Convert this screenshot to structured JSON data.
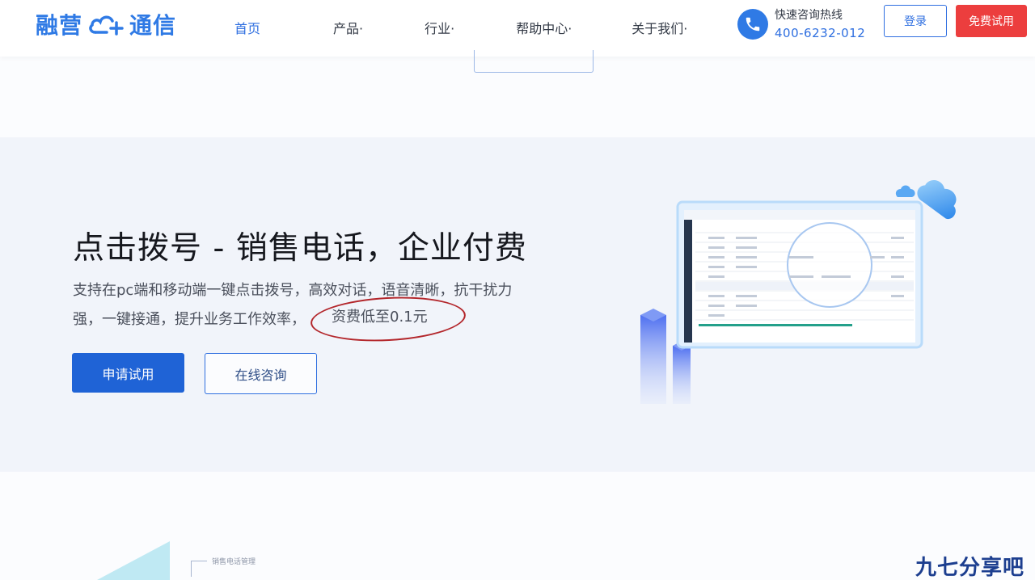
{
  "brand": {
    "name_left": "融营",
    "name_right": "通信"
  },
  "nav": {
    "items": [
      "首页",
      "产品·",
      "行业·",
      "帮助中心·",
      "关于我们·"
    ]
  },
  "contact": {
    "label": "快速咨询热线",
    "phone": "400-6232-012"
  },
  "header_buttons": {
    "login": "登录",
    "trial": "免费试用"
  },
  "hero": {
    "title": "点击拨号 - 销售电话，企业付费",
    "desc_line1": "支持在pc端和移动端一键点击拨号，高效对话，语音清晰，抗干扰力",
    "desc_line2": "强，一键接通，提升业务工作效率，",
    "price_note": "资费低至0.1元",
    "apply_button": "申请试用",
    "consult_button": "在线咨询"
  },
  "bottom": {
    "label": "销售电话管理"
  },
  "watermark": "九七分享吧",
  "colors": {
    "brand_blue": "#2f7ae5",
    "trial_red": "#ec3e3e",
    "apply_blue": "#1f63d6",
    "circle_red": "#b3262b"
  },
  "icons": {
    "phone": "phone-icon",
    "cloud": "cloud-plus-icon"
  }
}
